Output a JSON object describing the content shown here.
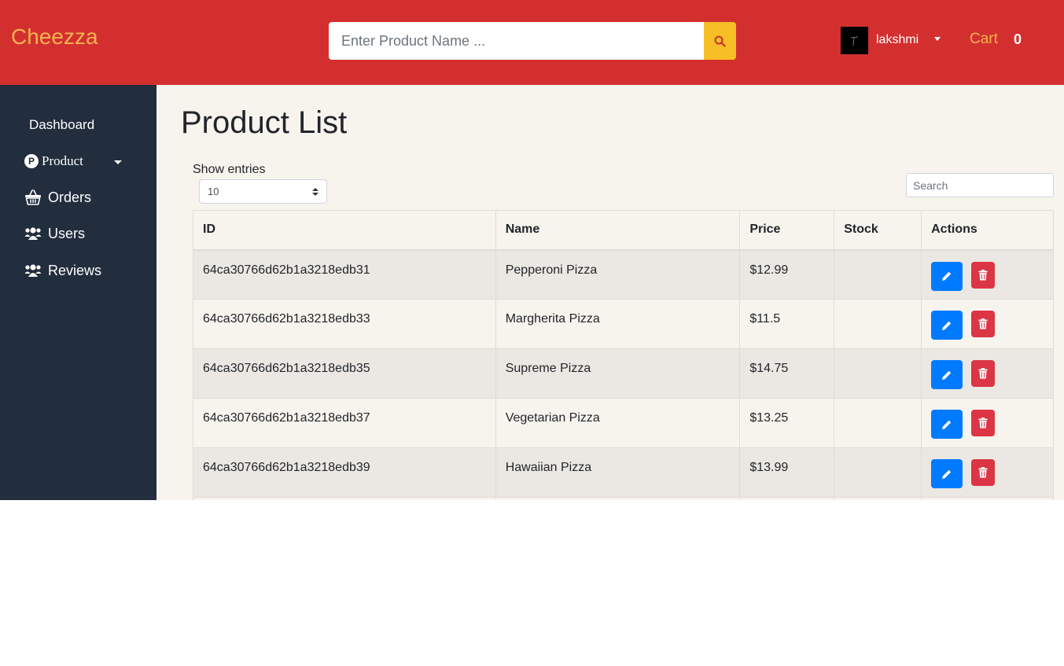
{
  "header": {
    "logo": "Cheezza",
    "search_placeholder": "Enter Product Name ...",
    "user_name": "lakshmi",
    "cart_label": "Cart",
    "cart_count": "0"
  },
  "sidebar": {
    "dashboard": "Dashboard",
    "product": "Product",
    "product_icon_letter": "P",
    "orders": "Orders",
    "users": "Users",
    "reviews": "Reviews"
  },
  "main": {
    "title": "Product List",
    "show_entries": "Show entries",
    "entries_value": "10",
    "search_placeholder": "Search",
    "columns": [
      "ID",
      "Name",
      "Price",
      "Stock",
      "Actions"
    ],
    "rows": [
      {
        "id": "64ca30766d62b1a3218edb31",
        "name": "Pepperoni Pizza",
        "price": "$12.99",
        "stock": ""
      },
      {
        "id": "64ca30766d62b1a3218edb33",
        "name": "Margherita Pizza",
        "price": "$11.5",
        "stock": ""
      },
      {
        "id": "64ca30766d62b1a3218edb35",
        "name": "Supreme Pizza",
        "price": "$14.75",
        "stock": ""
      },
      {
        "id": "64ca30766d62b1a3218edb37",
        "name": "Vegetarian Pizza",
        "price": "$13.25",
        "stock": ""
      },
      {
        "id": "64ca30766d62b1a3218edb39",
        "name": "Hawaiian Pizza",
        "price": "$13.99",
        "stock": ""
      }
    ]
  },
  "colors": {
    "header_bg": "#d32f2f",
    "logo": "#f4b350",
    "search_button": "#f6bf26",
    "sidebar_bg": "#222d3d",
    "main_bg": "#f7f4ee",
    "edit_button": "#007bff",
    "delete_button": "#dc3545"
  },
  "icons": {
    "search": "search-icon",
    "orders": "basket-icon",
    "users": "users-icon",
    "reviews": "users-icon",
    "edit": "pencil-icon",
    "delete": "trash-icon"
  }
}
